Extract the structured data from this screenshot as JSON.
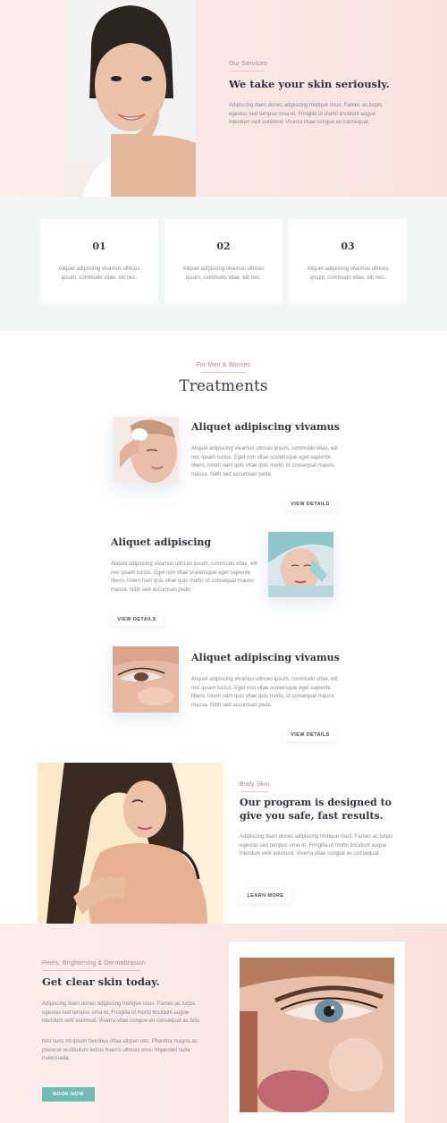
{
  "hero": {
    "eyebrow": "Our Services",
    "title": "We take your skin seriously.",
    "text": "Adipiscing diam donec adipiscing tristique risus. Fames ac turpis egestas sed tempus urna et. Fringilla ut morbi tincidunt augue interdum velit euismod. Viverra vitae congue eu consequat."
  },
  "features": [
    {
      "number": "01",
      "text": "Aliquet adipiscing vivamus ultrices ipsum, commodo vitae, elit nec."
    },
    {
      "number": "02",
      "text": "Aliquet adipiscing vivamus ultrices ipsum, commodo vitae, elit nec."
    },
    {
      "number": "03",
      "text": "Aliquet adipiscing vivamus ultrices ipsum, commodo vitae, elit nec."
    }
  ],
  "treatments": {
    "eyebrow": "For Men & Women",
    "title": "Treatments",
    "items": [
      {
        "title": "Aliquet adipiscing vivamus",
        "text": "Aliquet adipiscing vivamus ultrices ipsum, commodo vitae, elit nec ipsam luctus. Eget non vitae scelerisque eget sapiente libero, lorem nam quis vitae quis morbi, id consequat mauris massa. Nibh sed accumsan pede.",
        "button": "VIEW DETAILS"
      },
      {
        "title": "Aliquet adipiscing",
        "text": "Aliquet adipiscing vivamus ultrices ipsum, commodo vitae, elit nec ipsam luctus. Eget non vitae scelerisque eget sapiente libero, lorem nam quis vitae quis morbi, id consequat mauris massa. Nibh sed accumsan pede.",
        "button": "VIEW DETAILS"
      },
      {
        "title": "Aliquet adipiscing vivamus",
        "text": "Aliquet adipiscing vivamus ultrices ipsum, commodo vitae, elit nec ipsam luctus. Eget non vitae scelerisque eget sapiente libero, lorem nam quis vitae quis morbi, id consequat mauris massa. Nibh sed accumsan pede.",
        "button": "VIEW DETAILS"
      }
    ]
  },
  "body_skin": {
    "eyebrow": "Body Skin",
    "title": "Our program is designed to give you safe, fast results.",
    "text": "Adipiscing diam donec adipiscing tristique risus. Fames ac turpis egestas sed tempus urna et. Fringilla ut morbi tincidunt augue interdum velit euismod. Viverra vitae congue eu consequat.",
    "button": "LEARN MORE"
  },
  "clear_skin": {
    "eyebrow": "Peels, Brightening & Dermabrasion",
    "title": "Get clear skin today.",
    "text1": "Adipiscing diam donec adipiscing tristique risus. Fames ac turpis egestas sed tempus urna et. Fringilla ut morbi tincidunt augue interdum velit euismod. Viverra vitae congue eu consequat ac felis.",
    "text2": "Nisl nunc mi ipsum faucibus vitae aliquet nec. Pharetra magna ac placerat vestibulum lectus mauris ultrices eros. Imperdiet nulla malesuada.",
    "button": "BOOK NOW"
  },
  "colors": {
    "accent_teal": "#6fbcb6",
    "blush": "#f9e4e1",
    "mint_gray": "#f4f6f5",
    "eyebrow": "#b08a88",
    "heading": "#333340"
  }
}
